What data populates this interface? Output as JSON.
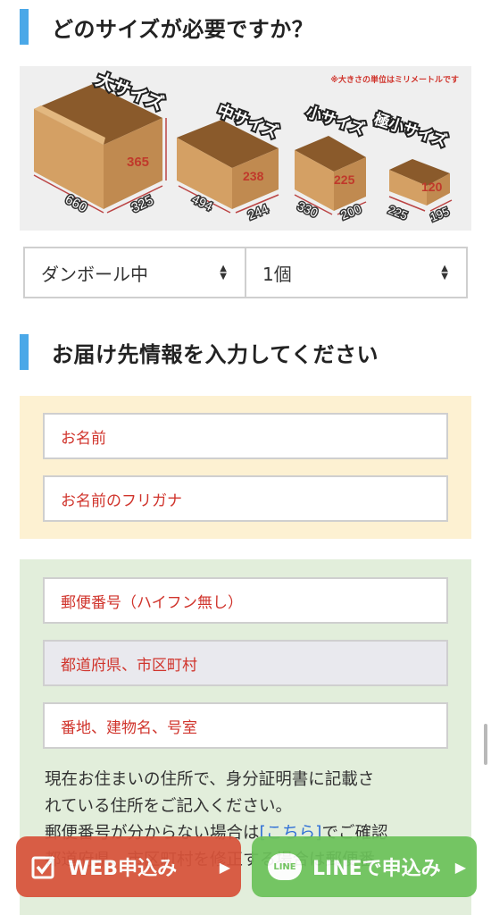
{
  "size_section": {
    "heading": "どのサイズが必要ですか？",
    "unit_note": "※大きさの単位はミリメートルです",
    "boxes": [
      {
        "name": "大サイズ",
        "width": "660",
        "depth": "325",
        "height": "365"
      },
      {
        "name": "中サイズ",
        "width": "494",
        "depth": "244",
        "height": "238"
      },
      {
        "name": "小サイズ",
        "width": "330",
        "depth": "200",
        "height": "225"
      },
      {
        "name": "極小サイズ",
        "width": "225",
        "depth": "195",
        "height": "120"
      }
    ]
  },
  "selects": {
    "box_type": "ダンボール中",
    "quantity": "1個"
  },
  "delivery_section": {
    "heading": "お届け先情報を入力してください",
    "name_placeholder": "お名前",
    "furigana_placeholder": "お名前のフリガナ",
    "postal_placeholder": "郵便番号（ハイフン無し）",
    "prefecture_city_placeholder": "都道府県、市区町村",
    "street_placeholder": "番地、建物名、号室",
    "notice_line1": "現在お住まいの住所で、身分証明書に記載さ",
    "notice_line2": "れている住所をご記入ください。",
    "notice_line3_pre": "郵便番号が分からない場合は",
    "notice_line3_link": "[こちら]",
    "notice_line3_post": "でご確認",
    "notice_line4": "都道府県、市区町村を修正する場合は郵便番"
  },
  "cta": {
    "web_label": "WEB申込み",
    "line_badge": "LINE",
    "line_label": "LINEで申込み"
  },
  "colors": {
    "accent_blue": "#4aa8e8",
    "placeholder_red": "#d0342c",
    "web_button": "#d8533a",
    "line_button": "#6cc25a"
  }
}
